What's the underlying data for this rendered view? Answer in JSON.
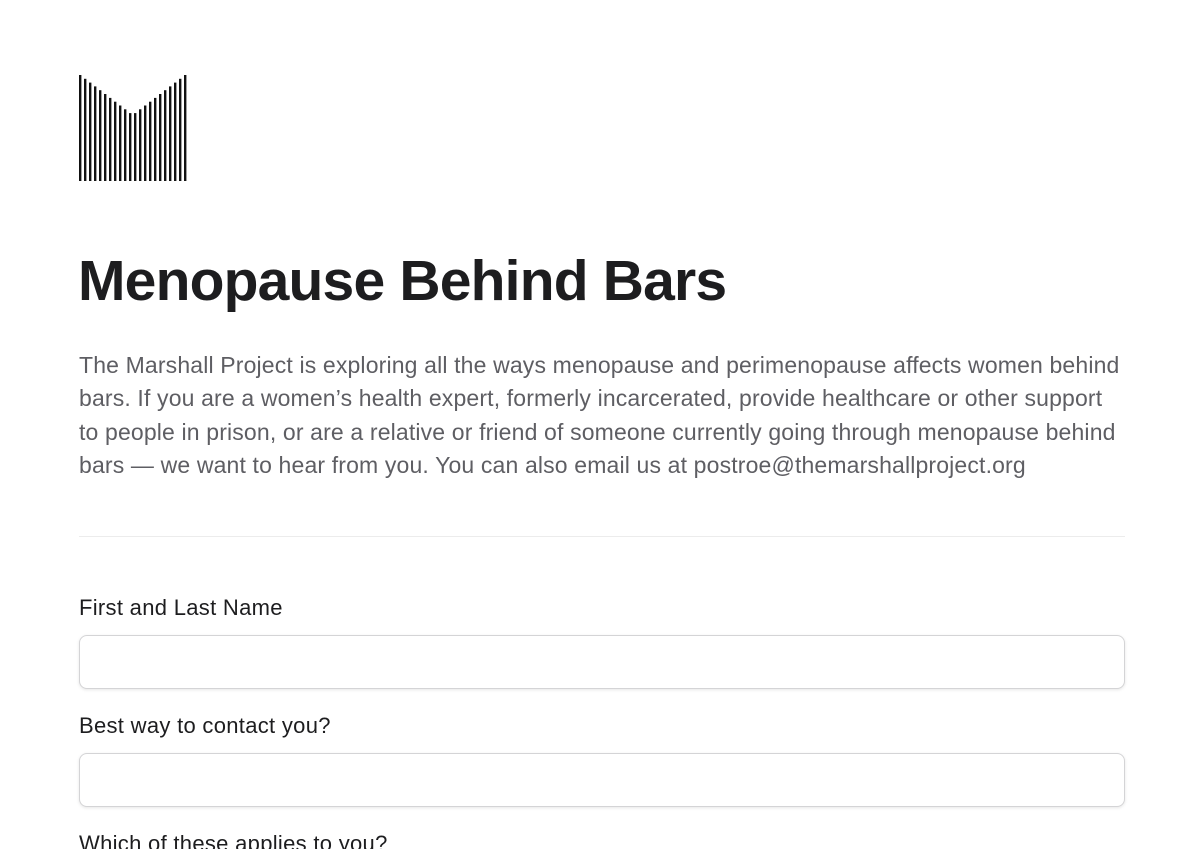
{
  "logo": {
    "icon": "marshall-project-logo-icon"
  },
  "header": {
    "title": "Menopause Behind Bars",
    "description": "The Marshall Project is exploring all the ways menopause and perimenopause affects women behind bars. If you are a women’s health expert, formerly incarcerated, provide healthcare or other support to people in prison, or are a relative or friend of someone currently going through menopause behind bars — we want to hear from you. You can also email us at postroe@themarshallproject.org"
  },
  "form": {
    "fields": [
      {
        "label": "First and Last Name",
        "value": "",
        "placeholder": ""
      },
      {
        "label": "Best way to contact you?",
        "value": "",
        "placeholder": ""
      },
      {
        "label": "Which of these applies to you?"
      }
    ]
  },
  "colors": {
    "title": "#1d1d1f",
    "description": "#5e5e63",
    "divider": "#ececec",
    "input_border": "#d4d4d6"
  }
}
